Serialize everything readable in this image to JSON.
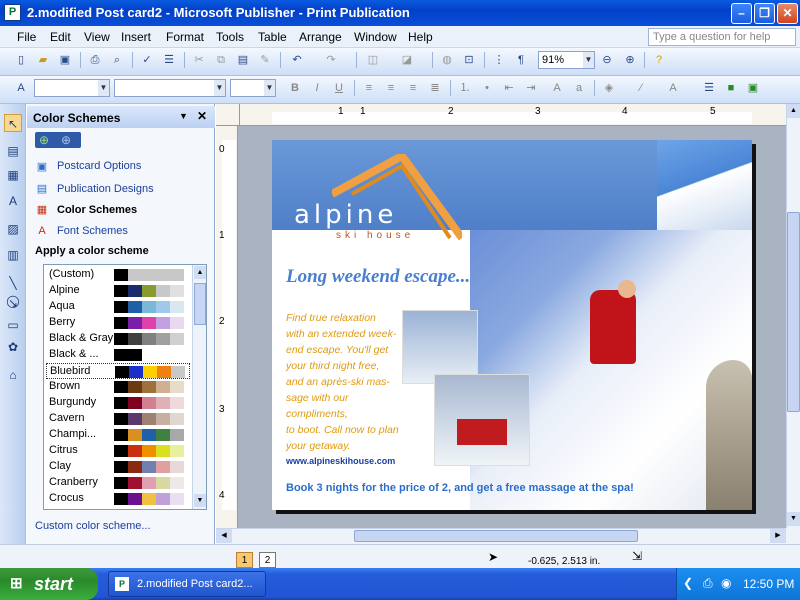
{
  "window": {
    "title": "2.modified Post card2 - Microsoft Publisher - Print Publication",
    "app_icon": "publisher-icon",
    "minimize": "–",
    "maximize": "❐",
    "close": "✕"
  },
  "menu": {
    "items": [
      "File",
      "Edit",
      "View",
      "Insert",
      "Format",
      "Tools",
      "Table",
      "Arrange",
      "Window",
      "Help"
    ],
    "ask_placeholder": "Type a question for help"
  },
  "toolbar": {
    "zoom": "91%"
  },
  "task_pane": {
    "title": "Color Schemes",
    "links": [
      {
        "label": "Postcard Options",
        "icon": "postcard-options-icon"
      },
      {
        "label": "Publication Designs",
        "icon": "publication-designs-icon"
      },
      {
        "label": "Color Schemes",
        "icon": "color-schemes-icon"
      },
      {
        "label": "Font Schemes",
        "icon": "font-schemes-icon"
      }
    ],
    "apply_heading": "Apply a color scheme",
    "schemes": [
      {
        "name": "(Custom)",
        "colors": [
          "#000000",
          "#c8c8c8",
          "#c8c8c8",
          "#c8c8c8",
          "#c8c8c8"
        ]
      },
      {
        "name": "Alpine",
        "colors": [
          "#000000",
          "#1a2b6e",
          "#8b9a2e",
          "#c8c8c8",
          "#e0e0e0"
        ]
      },
      {
        "name": "Aqua",
        "colors": [
          "#000000",
          "#1e5fa8",
          "#7bb8d8",
          "#a0c8e8",
          "#d8e8f0"
        ]
      },
      {
        "name": "Berry",
        "colors": [
          "#000000",
          "#7a1fa8",
          "#e040a8",
          "#c0a0e0",
          "#e8d8f0"
        ]
      },
      {
        "name": "Black & Gray",
        "colors": [
          "#000000",
          "#404040",
          "#808080",
          "#a0a0a0",
          "#d0d0d0"
        ]
      },
      {
        "name": "Black & ...",
        "colors": [
          "#000000",
          "#000000",
          "#ffffff",
          "#ffffff",
          "#ffffff"
        ]
      },
      {
        "name": "Bluebird",
        "colors": [
          "#000000",
          "#1a30c8",
          "#ffd000",
          "#f08010",
          "#c8c8c8"
        ]
      },
      {
        "name": "Brown",
        "colors": [
          "#000000",
          "#6b3a10",
          "#a0703a",
          "#d0b090",
          "#e8dcc8"
        ]
      },
      {
        "name": "Burgundy",
        "colors": [
          "#000000",
          "#800020",
          "#d08090",
          "#e0b0b8",
          "#f0d8dc"
        ]
      },
      {
        "name": "Cavern",
        "colors": [
          "#000000",
          "#5a3a6a",
          "#a08070",
          "#c8b0a0",
          "#e0d8d0"
        ]
      },
      {
        "name": "Champi...",
        "colors": [
          "#000000",
          "#d89020",
          "#2060a8",
          "#408040",
          "#a8a8a8"
        ]
      },
      {
        "name": "Citrus",
        "colors": [
          "#000000",
          "#c83010",
          "#f09000",
          "#d8e020",
          "#e8f0a0"
        ]
      },
      {
        "name": "Clay",
        "colors": [
          "#000000",
          "#8a2a10",
          "#7080b0",
          "#e0a0a0",
          "#e8d8d8"
        ]
      },
      {
        "name": "Cranberry",
        "colors": [
          "#000000",
          "#a01030",
          "#e0a0b0",
          "#d8d8a0",
          "#f0e8e8"
        ]
      },
      {
        "name": "Crocus",
        "colors": [
          "#000000",
          "#6a1090",
          "#f0c040",
          "#c0a0d8",
          "#e8e0f0"
        ]
      }
    ],
    "selected": "Bluebird",
    "custom_link": "Custom color scheme..."
  },
  "rulers": {
    "h_labels": [
      "1",
      "1",
      "2",
      "3",
      "4",
      "5"
    ],
    "v_labels": [
      "0",
      "1",
      "2",
      "3",
      "4"
    ]
  },
  "postcard": {
    "logo": "alpine",
    "logo_sub": "ski house",
    "headline": "Long weekend escape...",
    "body_lines": [
      "Find true relaxation",
      "with an extended week-",
      "end escape. You'll get",
      "your third night free,",
      "and an après-ski mas-",
      "sage with our compliments,",
      "to boot. Call now to plan",
      "your getaway."
    ],
    "url": "www.alpineskihouse.com",
    "offer": "Book 3 nights for the price of 2, and get a free massage at the spa!"
  },
  "status": {
    "pages": [
      "1",
      "2"
    ],
    "position": "-0.625, 2.513 in."
  },
  "taskbar": {
    "start": "start",
    "task": "2.modified Post card2...",
    "clock": "12:50 PM"
  }
}
